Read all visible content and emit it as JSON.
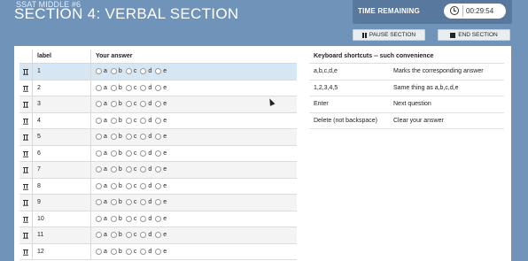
{
  "header": {
    "subtitle": "SSAT MIDDLE #6",
    "title": "SECTION 4: VERBAL SECTION"
  },
  "timer": {
    "label": "TIME REMAINING",
    "value": "00:29:54",
    "icon": "clock-icon"
  },
  "buttons": {
    "pause": "PAUSE SECTION",
    "end": "END SECTION"
  },
  "answer_table": {
    "headers": {
      "label": "label",
      "answer": "Your answer"
    },
    "options": [
      "a",
      "b",
      "c",
      "d",
      "e"
    ],
    "rows": [
      {
        "label": "1"
      },
      {
        "label": "2"
      },
      {
        "label": "3"
      },
      {
        "label": "4"
      },
      {
        "label": "5"
      },
      {
        "label": "6"
      },
      {
        "label": "7"
      },
      {
        "label": "8"
      },
      {
        "label": "9"
      },
      {
        "label": "10"
      },
      {
        "label": "11"
      },
      {
        "label": "12"
      }
    ],
    "highlighted_row": 0
  },
  "shortcuts": {
    "title": "Keyboard shortcuts -- such convenience",
    "rows": [
      {
        "key": "a,b,c,d,e",
        "desc": "Marks the corresponding answer"
      },
      {
        "key": "1,2,3,4,5",
        "desc": "Same thing as a,b,c,d,e"
      },
      {
        "key": "Enter",
        "desc": "Next question"
      },
      {
        "key": "Delete (not backspace)",
        "desc": "Clear your answer"
      }
    ]
  },
  "colors": {
    "background": "#7093b9",
    "highlight": "#d7e6f3"
  }
}
